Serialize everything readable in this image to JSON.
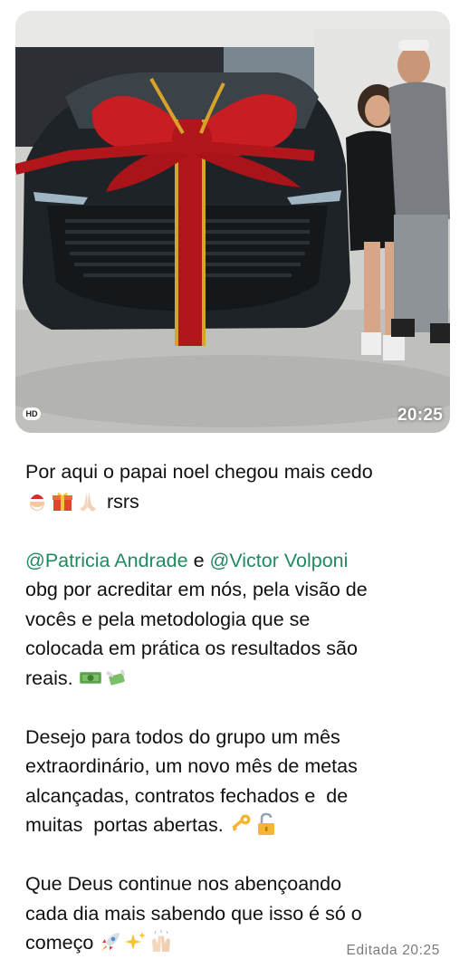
{
  "photo": {
    "hd_badge": "HD",
    "timestamp": "20:25"
  },
  "message": {
    "line1": "Por aqui o papai noel chegou mais cedo",
    "line2_suffix": "rsrs",
    "emojis_line2": [
      "santa-emoji",
      "gift-emoji",
      "praying-hands-emoji"
    ],
    "mention1": "@Patricia Andrade",
    "conj": " e ",
    "mention2": "@Victor Volponi",
    "p2_line2": "obg por acreditar em nós, pela visão de",
    "p2_line3": "vocês e pela metodologia que se",
    "p2_line4": "colocada em prática os resultados são",
    "p2_line5": "reais.",
    "emojis_p2": [
      "dollar-bill-emoji",
      "money-with-wings-emoji"
    ],
    "p3_line1": "Desejo para todos do grupo um mês",
    "p3_line2": "extraordinário, um novo mês de metas",
    "p3_line3": "alcançadas, contratos fechados e  de",
    "p3_line4": "muitas  portas abertas.",
    "emojis_p3": [
      "key-emoji",
      "unlocked-emoji"
    ],
    "p4_line1": "Que Deus continue nos abençoando",
    "p4_line2": "cada dia mais sabendo que isso é só o",
    "p4_line3": "começo",
    "emojis_p4": [
      "rocket-emoji",
      "sparkles-emoji",
      "raising-hands-emoji"
    ]
  },
  "footer": {
    "edited_label": "Editada",
    "time": "20:25"
  },
  "colors": {
    "mention": "#1f8a5e",
    "text": "#111111",
    "meta": "#7b7b7b"
  }
}
